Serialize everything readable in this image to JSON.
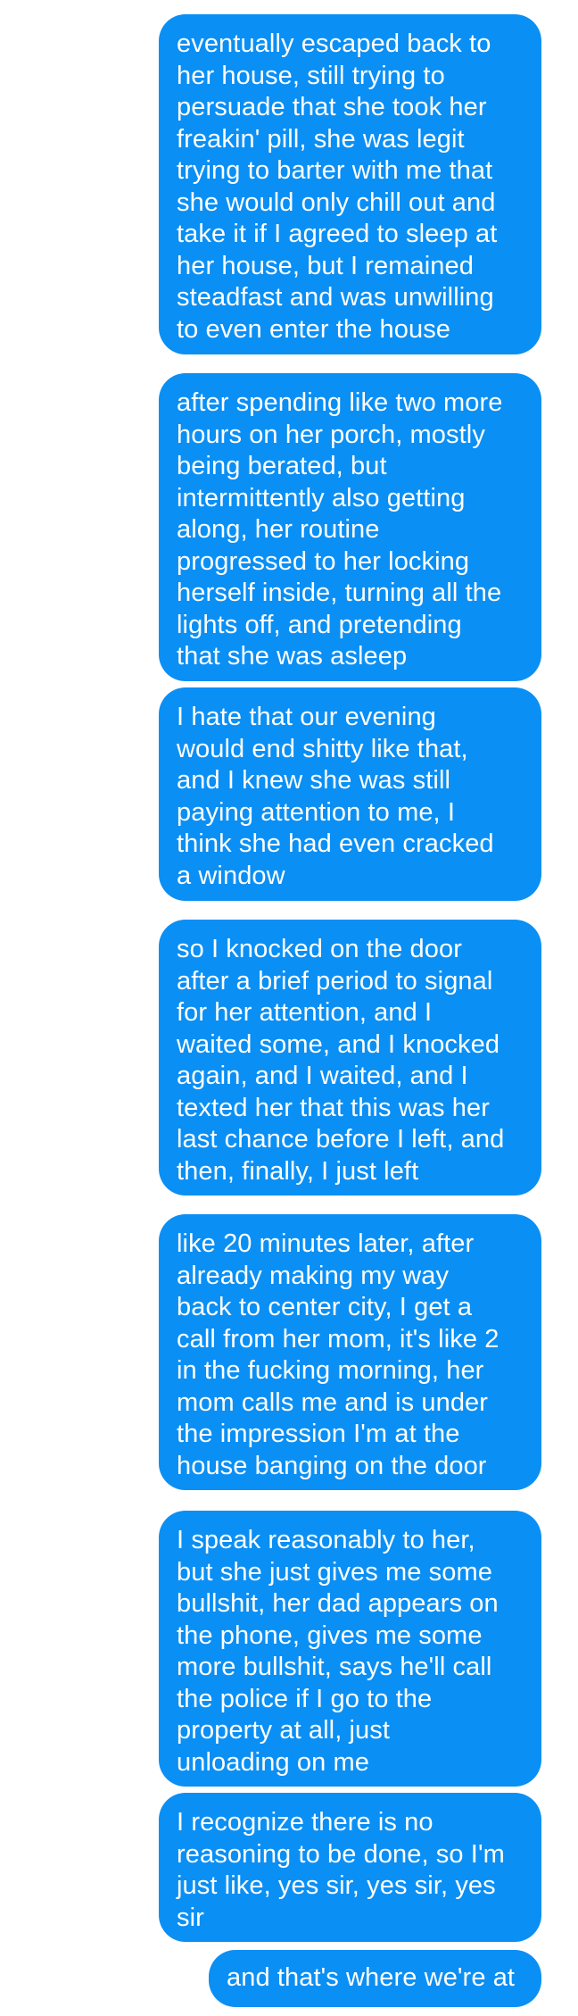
{
  "colors": {
    "bubble_background": "#0a8ff5",
    "bubble_text": "#ffffff",
    "page_background": "#ffffff"
  },
  "messages": [
    {
      "sender": "me",
      "text": "eventually escaped back to\nher house, still trying to\npersuade that she took her\nfreakin' pill, she was legit\ntrying to barter with me that\nshe would only chill out and\ntake it if I agreed to sleep at\nher house, but I remained\nsteadfast and was unwilling\nto even enter the house"
    },
    {
      "sender": "me",
      "text": "after spending like two more\nhours on her porch, mostly\nbeing berated, but\nintermittently also getting\nalong, her routine\nprogressed to her locking\nherself inside, turning all the\nlights off, and pretending\nthat she was asleep"
    },
    {
      "sender": "me",
      "text": "I hate that our evening\nwould end shitty like that,\nand I knew she was still\npaying attention to me, I\nthink she had even cracked\na window"
    },
    {
      "sender": "me",
      "text": "so I knocked on the door\nafter a brief period to signal\nfor her attention, and I\nwaited some, and I knocked\nagain, and I waited, and I\ntexted her that this was her\nlast chance before I left, and\nthen, finally, I just left"
    },
    {
      "sender": "me",
      "text": "like 20 minutes later, after\nalready making my way\nback to center city, I get a\ncall from her mom, it's like 2\nin the fucking morning, her\nmom calls me and is under\nthe impression I'm at the\nhouse banging on the door"
    },
    {
      "sender": "me",
      "text": "I speak reasonably to her,\nbut she just gives me some\nbullshit, her dad appears on\nthe phone, gives me some\nmore bullshit, says he'll call\nthe police if I go to the\nproperty at all, just\nunloading on me"
    },
    {
      "sender": "me",
      "text": "I recognize there is no\nreasoning to be done, so I'm\njust like, yes sir, yes sir, yes\nsir"
    },
    {
      "sender": "me",
      "text": "and that's where we're at"
    }
  ]
}
